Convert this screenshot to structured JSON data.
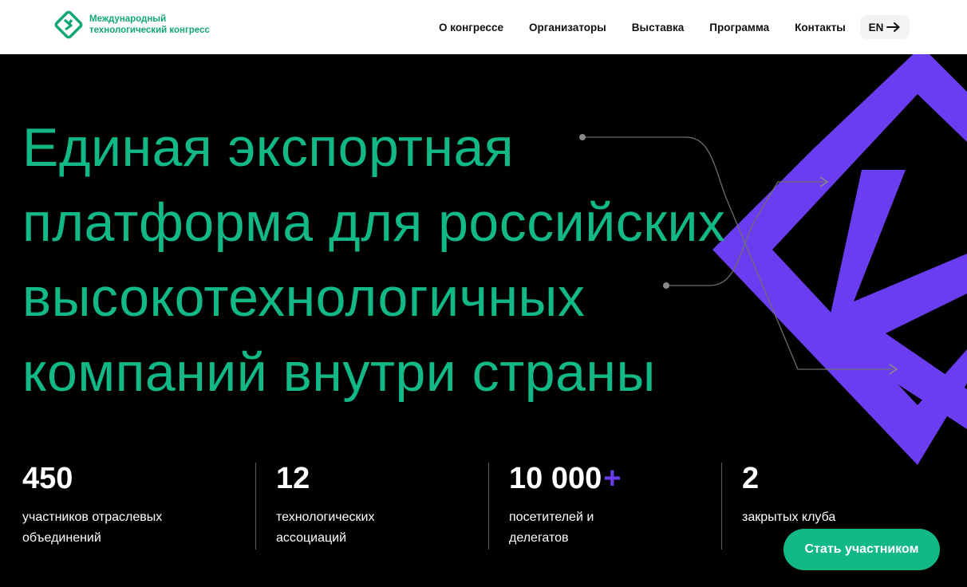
{
  "brand": {
    "logo_icon": "congress-logo-icon",
    "name_line1": "Международный",
    "name_line2": "технологический конгресс",
    "accent_color": "#12b886",
    "purple_color": "#6b3df0"
  },
  "nav": {
    "items": [
      {
        "label": "О конгрессе"
      },
      {
        "label": "Организаторы"
      },
      {
        "label": "Выставка"
      },
      {
        "label": "Программа"
      },
      {
        "label": "Контакты"
      }
    ],
    "language": {
      "label": "EN",
      "icon": "arrow-right-icon"
    }
  },
  "hero": {
    "headline_lines": [
      "Единая экспортная",
      "платформа для российских",
      "высокотехнологичных",
      "компаний внутри страны"
    ],
    "stats": [
      {
        "number": "450",
        "suffix": "",
        "label_line1": "участников отраслевых",
        "label_line2": "объединений"
      },
      {
        "number": "12",
        "suffix": "",
        "label_line1": "технологических",
        "label_line2": "ассоциаций"
      },
      {
        "number": "10 000",
        "suffix": "+",
        "label_line1": "посетителей и",
        "label_line2": "делегатов"
      },
      {
        "number": "2",
        "suffix": "",
        "label_line1": "закрытых клуба",
        "label_line2": ""
      }
    ],
    "cta_label": "Стать участником"
  }
}
